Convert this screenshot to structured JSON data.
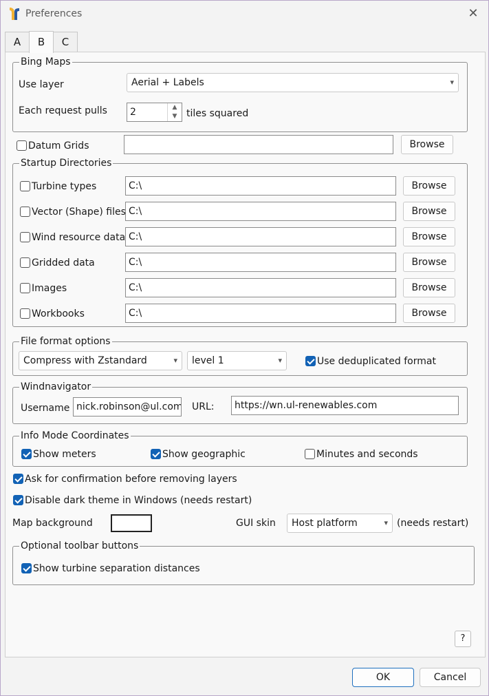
{
  "window": {
    "title": "Preferences"
  },
  "tabs": [
    {
      "label": "A"
    },
    {
      "label": "B"
    },
    {
      "label": "C"
    }
  ],
  "bing_maps": {
    "group_title": "Bing Maps",
    "use_layer_label": "Use layer",
    "use_layer_value": "Aerial + Labels",
    "request_label": "Each request pulls",
    "request_value": "2",
    "request_suffix": "tiles squared"
  },
  "datum_grids": {
    "label": "Datum Grids",
    "checked": false,
    "value": "",
    "browse": "Browse"
  },
  "startup": {
    "group_title": "Startup Directories",
    "rows": [
      {
        "label": "Turbine types",
        "value": "C:\\",
        "browse": "Browse",
        "checked": false
      },
      {
        "label": "Vector (Shape) files",
        "value": "C:\\",
        "browse": "Browse",
        "checked": false
      },
      {
        "label": "Wind resource data",
        "value": "C:\\",
        "browse": "Browse",
        "checked": false
      },
      {
        "label": "Gridded data",
        "value": "C:\\",
        "browse": "Browse",
        "checked": false
      },
      {
        "label": "Images",
        "value": "C:\\",
        "browse": "Browse",
        "checked": false
      },
      {
        "label": "Workbooks",
        "value": "C:\\",
        "browse": "Browse",
        "checked": false
      }
    ]
  },
  "file_format": {
    "group_title": "File format options",
    "compression": "Compress with Zstandard",
    "level": "level 1",
    "dedup_label": "Use deduplicated format",
    "dedup_checked": true
  },
  "windnavigator": {
    "group_title": "Windnavigator",
    "username_label": "Username",
    "username_value": "nick.robinson@ul.com",
    "url_label": "URL:",
    "url_value": "https://wn.ul-renewables.com"
  },
  "info_mode": {
    "group_title": "Info Mode Coordinates",
    "show_meters": "Show meters",
    "show_meters_checked": true,
    "show_geographic": "Show geographic",
    "show_geographic_checked": true,
    "minutes_seconds": "Minutes and seconds",
    "minutes_seconds_checked": false
  },
  "options": {
    "confirm_remove": "Ask for confirmation before removing layers",
    "confirm_remove_checked": true,
    "disable_dark": "Disable dark theme in Windows (needs restart)",
    "disable_dark_checked": true,
    "map_background_label": "Map background",
    "map_background_color": "#ffffff",
    "gui_skin_label": "GUI skin",
    "gui_skin_value": "Host platform",
    "gui_skin_note": "(needs restart)"
  },
  "toolbar": {
    "group_title": "Optional toolbar buttons",
    "show_separation": "Show turbine separation distances",
    "show_separation_checked": true
  },
  "footer": {
    "help": "?",
    "ok": "OK",
    "cancel": "Cancel"
  },
  "colors": {
    "accent": "#1262b5",
    "border": "#8f8f8f",
    "background": "#f9f9f9"
  }
}
